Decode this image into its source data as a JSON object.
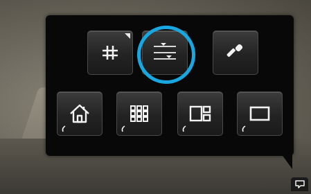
{
  "toolbar": {
    "top_row": [
      {
        "icon": "grid-icon",
        "has_submenu": true
      },
      {
        "icon": "align-sliders-icon",
        "highlighted": true
      },
      {
        "icon": "eyedropper-icon"
      }
    ],
    "bottom_row": [
      {
        "icon": "home-icon"
      },
      {
        "icon": "thumbnail-grid-icon"
      },
      {
        "icon": "split-view-icon"
      },
      {
        "icon": "single-view-icon"
      }
    ]
  },
  "colors": {
    "panel": "#080808",
    "highlight": "#18a7e0",
    "icon": "#f2f2f2"
  }
}
